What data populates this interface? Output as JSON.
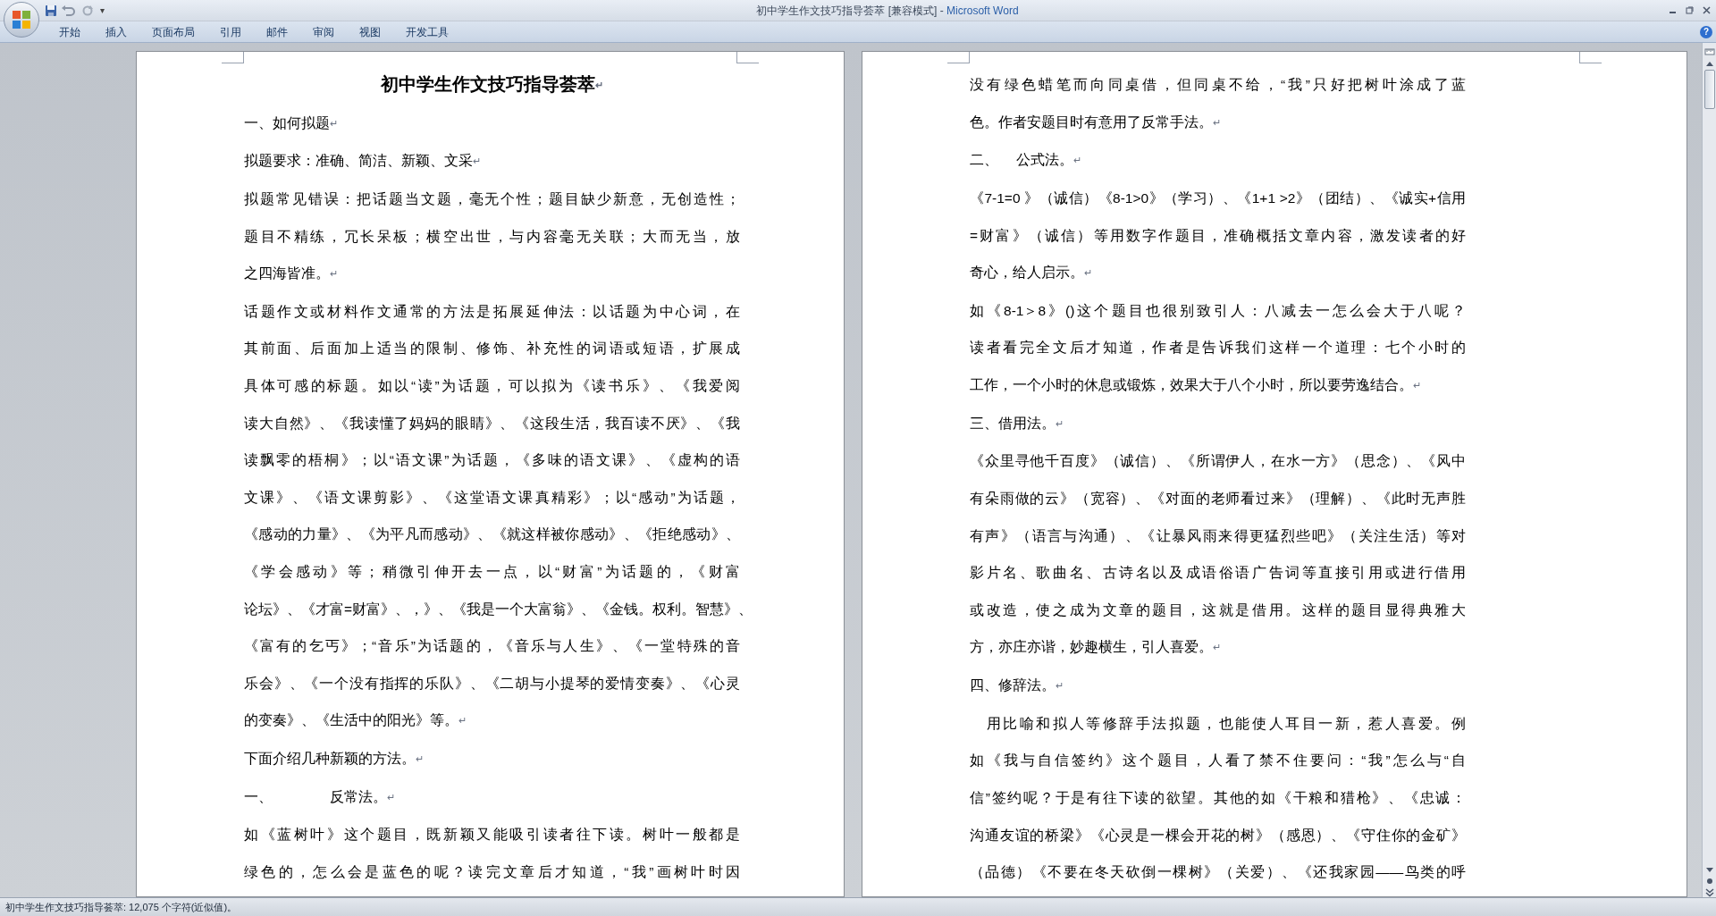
{
  "window": {
    "title": "初中学生作文技巧指导荟萃 [兼容模式]",
    "separator": " - ",
    "app_name": "Microsoft Word"
  },
  "quick_access": {
    "menu": "▾"
  },
  "tabs": [
    {
      "label": "开始"
    },
    {
      "label": "插入"
    },
    {
      "label": "页面布局"
    },
    {
      "label": "引用"
    },
    {
      "label": "邮件"
    },
    {
      "label": "审阅"
    },
    {
      "label": "视图"
    },
    {
      "label": "开发工具"
    }
  ],
  "help": "?",
  "pages": [
    {
      "paragraphs": [
        {
          "kind": "title",
          "lines": [
            "初中学生作文技巧指导荟萃"
          ],
          "end_mark": "↵"
        },
        {
          "kind": "body",
          "lines": [
            "一、如何拟题"
          ],
          "end_mark": "↵"
        },
        {
          "kind": "body",
          "lines": [
            "拟题要求：准确、简洁、新颖、文采"
          ],
          "end_mark": "↵"
        },
        {
          "kind": "body",
          "lines": [
            "拟题常见错误：把话题当文题，毫无个性；题目缺少新意，无创造性；",
            "题目不精练，冗长呆板；横空出世，与内容毫无关联；大而无当，放",
            "之四海皆准。"
          ],
          "end_mark": "↵"
        },
        {
          "kind": "body",
          "lines": [
            "话题作文或材料作文通常的方法是拓展延伸法：以话题为中心词，在",
            "其前面、后面加上适当的限制、修饰、补充性的词语或短语，扩展成",
            "具体可感的标题。如以“读”为话题，可以拟为《读书乐》、《我爱阅",
            "读大自然》、《我读懂了妈妈的眼睛》、《这段生活，我百读不厌》、《我",
            "读飘零的梧桐》；以“语文课”为话题，《多味的语文课》、《虚构的语",
            "文课》、《语文课剪影》、《这堂语文课真精彩》；以“感动”为话题，",
            "《感动的力量》、《为平凡而感动》、《就这样被你感动》、《拒绝感动》、",
            "《学会感动》等；稍微引伸开去一点，以“财富”为话题的，《财富",
            "论坛》、《才富=财富》、，》、《我是一个大富翁》、《金钱。权利。智慧》、",
            "《富有的乞丐》；“音乐”为话题的，《音乐与人生》、《一堂特殊的音",
            "乐会》、《一个没有指挥的乐队》、《二胡与小提琴的爱情变奏》、《心灵",
            "的变奏》、《生活中的阳光》等。"
          ],
          "end_mark": "↵"
        },
        {
          "kind": "body",
          "lines": [
            "下面介绍几种新颖的方法。"
          ],
          "end_mark": "↵"
        },
        {
          "kind": "body",
          "lines": [
            "一、　　　　反常法。"
          ],
          "end_mark": "↵"
        },
        {
          "kind": "body",
          "lines": [
            "如《蓝树叶》这个题目，既新颖又能吸引读者往下读。树叶一般都是",
            "绿色的，怎么会是蓝色的呢？读完文章后才知道，“我”画树叶时因"
          ]
        }
      ]
    },
    {
      "paragraphs": [
        {
          "kind": "body",
          "lines": [
            "没有绿色蜡笔而向同桌借，但同桌不给，“我”只好把树叶涂成了蓝",
            "色。作者安题目时有意用了反常手法。"
          ],
          "end_mark": "↵"
        },
        {
          "kind": "body",
          "lines": [
            "二、　 公式法。"
          ],
          "end_mark": "↵"
        },
        {
          "kind": "body",
          "lines": [
            "《7-1=0 》（诚信）《8-1>0》（学习）、《1+1 >2》（团结）、《诚实+信用",
            "=财富》（诚信）等用数字作题目，准确概括文章内容，激发读者的好",
            "奇心，给人启示。"
          ],
          "end_mark": "↵"
        },
        {
          "kind": "body",
          "lines": [
            "如《8-1＞8》()这个题目也很别致引人：八减去一怎么会大于八呢？",
            "读者看完全文后才知道，作者是告诉我们这样一个道理：七个小时的",
            "工作，一个小时的休息或锻炼，效果大于八个小时，所以要劳逸结合。"
          ],
          "end_mark": "↵"
        },
        {
          "kind": "body",
          "lines": [
            "三、借用法。"
          ],
          "end_mark": "↵"
        },
        {
          "kind": "body",
          "lines": [
            "《众里寻他千百度》（诚信）、《所谓伊人，在水一方》（思念）、《风中",
            "有朵雨做的云》（宽容）、《对面的老师看过来》（理解）、《此时无声胜",
            "有声》（语言与沟通）、《让暴风雨来得更猛烈些吧》（关注生活）等对",
            "影片名、歌曲名、古诗名以及成语俗语广告词等直接引用或进行借用",
            "或改造，使之成为文章的题目，这就是借用。这样的题目显得典雅大",
            "方，亦庄亦谐，妙趣横生，引人喜爱。"
          ],
          "end_mark": "↵"
        },
        {
          "kind": "body",
          "lines": [
            "四、修辞法。"
          ],
          "end_mark": "↵"
        },
        {
          "kind": "body",
          "lines": [
            "　用比喻和拟人等修辞手法拟题，也能使人耳目一新，惹人喜爱。例",
            "如《我与自信签约》这个题目，人看了禁不住要问：“我”怎么与“自",
            "信”签约呢？于是有往下读的欲望。其他的如《干粮和猎枪》、《忠诚：",
            "沟通友谊的桥梁》《心灵是一棵会开花的树》（感恩）、《守住你的金矿》",
            "（品德）《不要在冬天砍倒一棵树》（关爱）、《还我家园——鸟类的呼"
          ]
        }
      ]
    }
  ],
  "status_bar": {
    "text": "初中学生作文技巧指导荟萃: 12,075 个字符(近似值)。"
  }
}
